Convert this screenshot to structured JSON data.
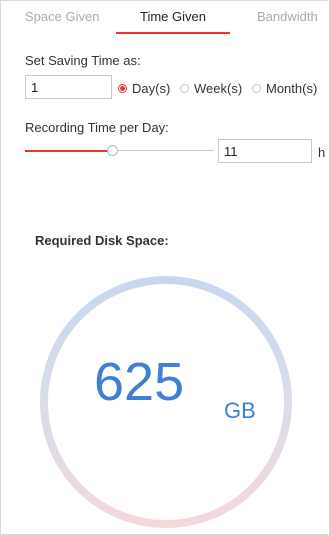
{
  "tabs": [
    {
      "label": "Space Given",
      "active": false
    },
    {
      "label": "Time Given",
      "active": true
    },
    {
      "label": "Bandwidth",
      "active": false
    }
  ],
  "saving_time": {
    "label": "Set Saving Time as:",
    "value": "1",
    "options": [
      {
        "label": "Day(s)",
        "checked": true
      },
      {
        "label": "Week(s)",
        "checked": false
      },
      {
        "label": "Month(s)",
        "checked": false
      }
    ]
  },
  "recording_time": {
    "label": "Recording Time per Day:",
    "value": "11",
    "unit": "h",
    "slider_fraction": 0.46
  },
  "result": {
    "label": "Required Disk Space:",
    "value": "625",
    "unit": "GB"
  },
  "colors": {
    "accent": "#e7352f",
    "value_blue": "#3f7fd6",
    "gauge_top": "#c7d7ef",
    "gauge_bottom": "#f3d8dc"
  }
}
